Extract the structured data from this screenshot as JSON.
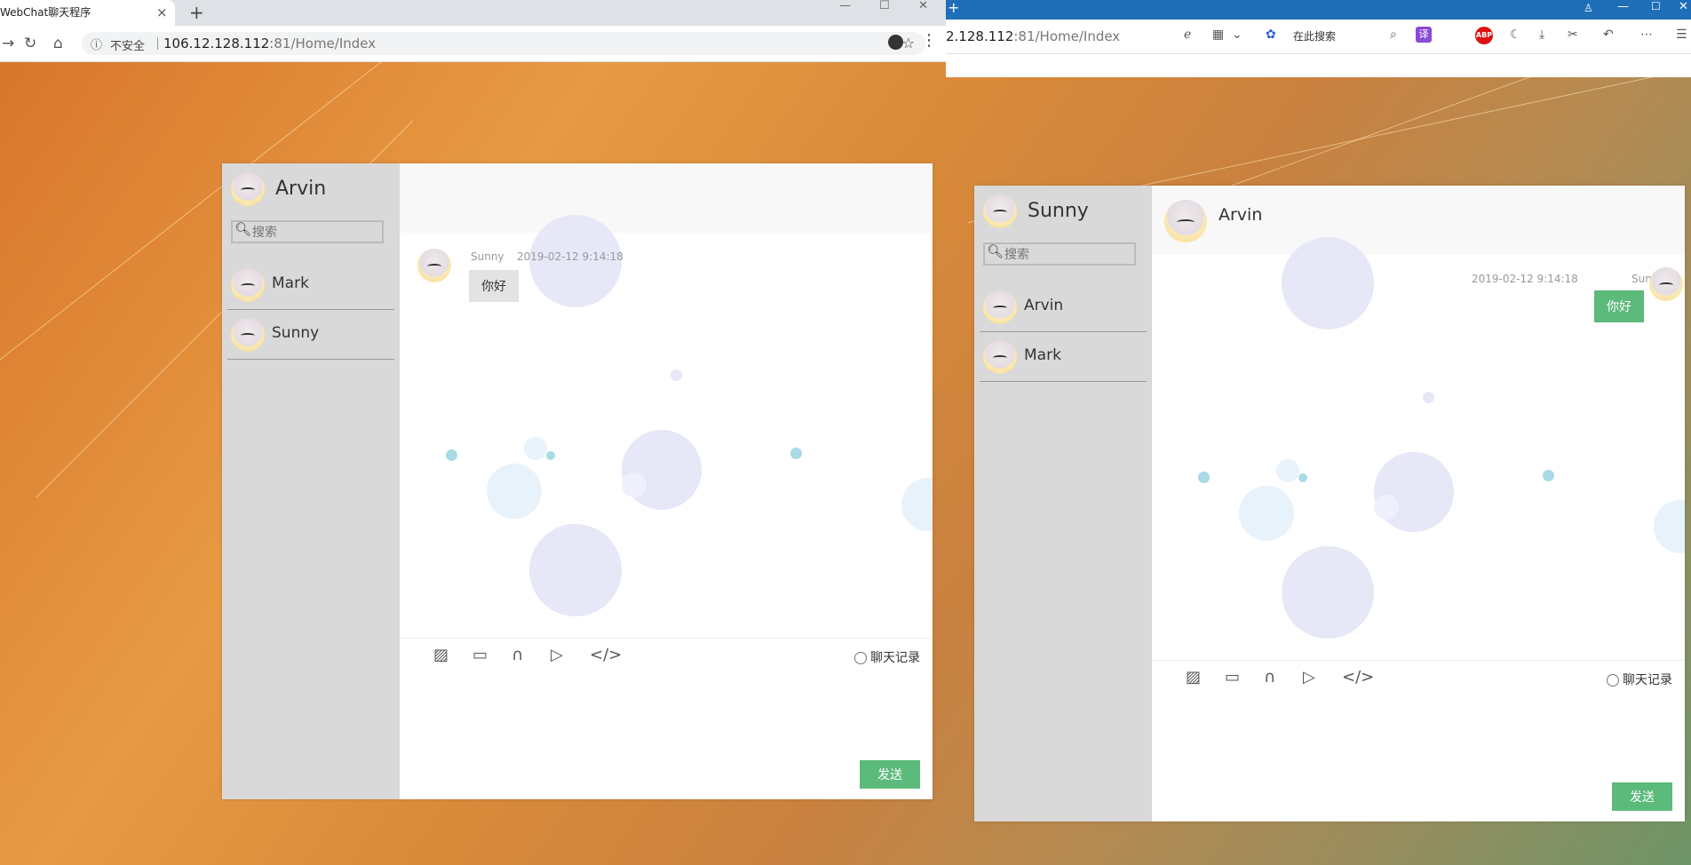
{
  "left_browser": {
    "tab_title": "WebChat聊天程序",
    "tab_close": "×",
    "new_tab": "+",
    "security_icon": "info-circle",
    "security_text": "不安全",
    "url_host": "106.12.128.112",
    "url_rest": ":81/Home/Index"
  },
  "right_browser": {
    "url_host": "2.128.112",
    "url_rest": ":81/Home/Index",
    "search_text": "在此搜索",
    "translate_label": "译",
    "abp_label": "ABP"
  },
  "left_chat": {
    "me": "Arvin",
    "search_placeholder": "搜索",
    "contacts": [
      {
        "name": "Mark"
      },
      {
        "name": "Sunny"
      }
    ],
    "active_contact": "",
    "messages": [
      {
        "from": "Sunny",
        "time": "2019-02-12 9:14:18",
        "text": "你好",
        "side": "left"
      }
    ],
    "history_label": "聊天记录",
    "send_label": "发送"
  },
  "right_chat": {
    "me": "Sunny",
    "search_placeholder": "搜索",
    "contacts": [
      {
        "name": "Arvin"
      },
      {
        "name": "Mark"
      }
    ],
    "active_contact": "Arvin",
    "messages": [
      {
        "from": "Sunny",
        "time": "2019-02-12 9:14:18",
        "text": "你好",
        "side": "right"
      }
    ],
    "history_label": "聊天记录",
    "send_label": "发送"
  },
  "colors": {
    "send_green": "#5cba7b",
    "sidebar_gray": "#d9d9d9",
    "titlebar_blue": "#1e6fb7"
  }
}
